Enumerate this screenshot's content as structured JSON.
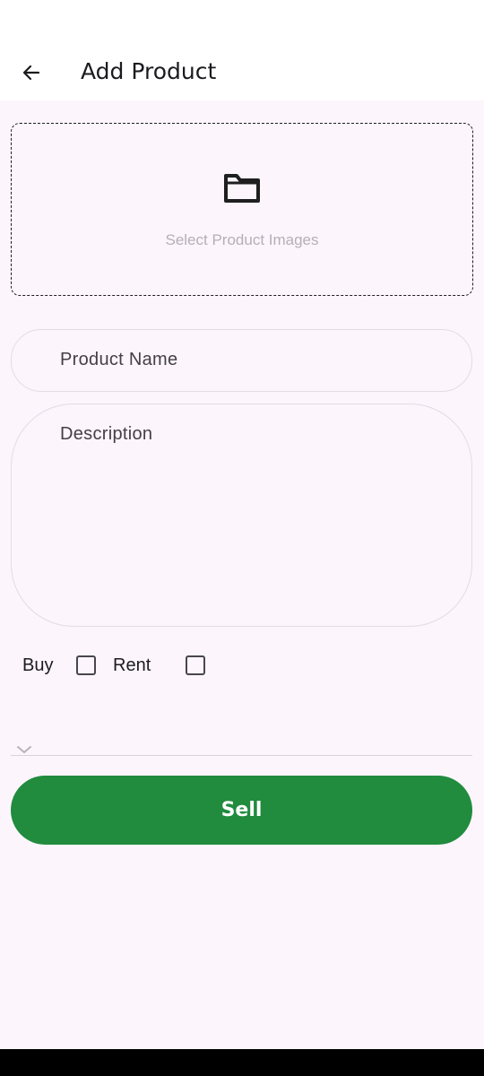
{
  "app_bar": {
    "title": "Add Product",
    "back_icon": "arrow-left-icon"
  },
  "image_picker": {
    "icon": "folder-icon",
    "label": "Select Product Images"
  },
  "form": {
    "product_name_placeholder": "Product Name",
    "description_placeholder": "Description",
    "options": [
      {
        "label": "Buy",
        "checked": false
      },
      {
        "label": "Rent",
        "checked": false
      }
    ],
    "dropdown": {
      "icon": "chevron-down-icon",
      "selected": ""
    }
  },
  "actions": {
    "sell_label": "Sell"
  },
  "colors": {
    "background": "#fcf5fc",
    "primary_button": "#218b3e",
    "app_bar": "#ffffff"
  }
}
